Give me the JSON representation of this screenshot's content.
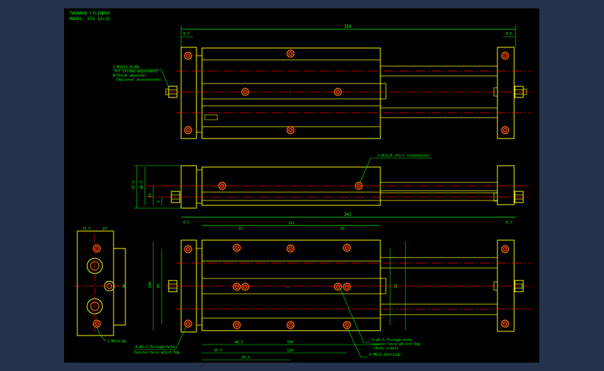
{
  "title_block": {
    "line1": "TWINROD CYLINDER",
    "line2": "MODEL: STG 32×25"
  },
  "notes": {
    "stroke_adjust_1": "2-M10×1.0x38L",
    "stroke_adjust_2": "for stroke adjustment",
    "stroke_adjust_3": "W/Shock absorber",
    "stroke_adjust_4": "(Optional accessories)",
    "port_connection": "2-Rc1/8 (Port connection)",
    "through_hole_left_1": "4-ø5.5 Through-hole",
    "through_hole_left_2": "Counter bore ø11×5.5dp",
    "through_hole_right_1": "4-ø5.5 Through-hole",
    "through_hole_right_2": "Counter bore ø9.6×5.5dp",
    "through_hole_right_3": "(Both sides)",
    "tapped_holes": "6-M6x1.0pth12dp",
    "side_tap": "2-M5×0.8p"
  },
  "dimensions": {
    "top_width": "359",
    "top_left": "8.5",
    "top_right": "8.5",
    "height_outer": "42.5",
    "height_inner": "40.5",
    "height_19": "19",
    "height_6": "6",
    "bottom_width": "342",
    "bottom_left": "8.5",
    "bottom_right": "8.3",
    "span_191": "191",
    "w10_left": "10",
    "w10_right": "10",
    "end_21_5": "21.5",
    "end_10": "10",
    "end_90": "90",
    "h_100": "100",
    "h_80": "80",
    "h_53": "53",
    "h_96": "96",
    "b_65": "ø6.5",
    "b_100": "100",
    "b_35_5": "35.5",
    "b_120": "120",
    "b_95_5": "95.5"
  },
  "colors": {
    "outline": "#ffff00",
    "dimension": "#00ff00",
    "centerline": "#ff0000",
    "hole": "#ff7f00",
    "text": "#00ff00"
  }
}
